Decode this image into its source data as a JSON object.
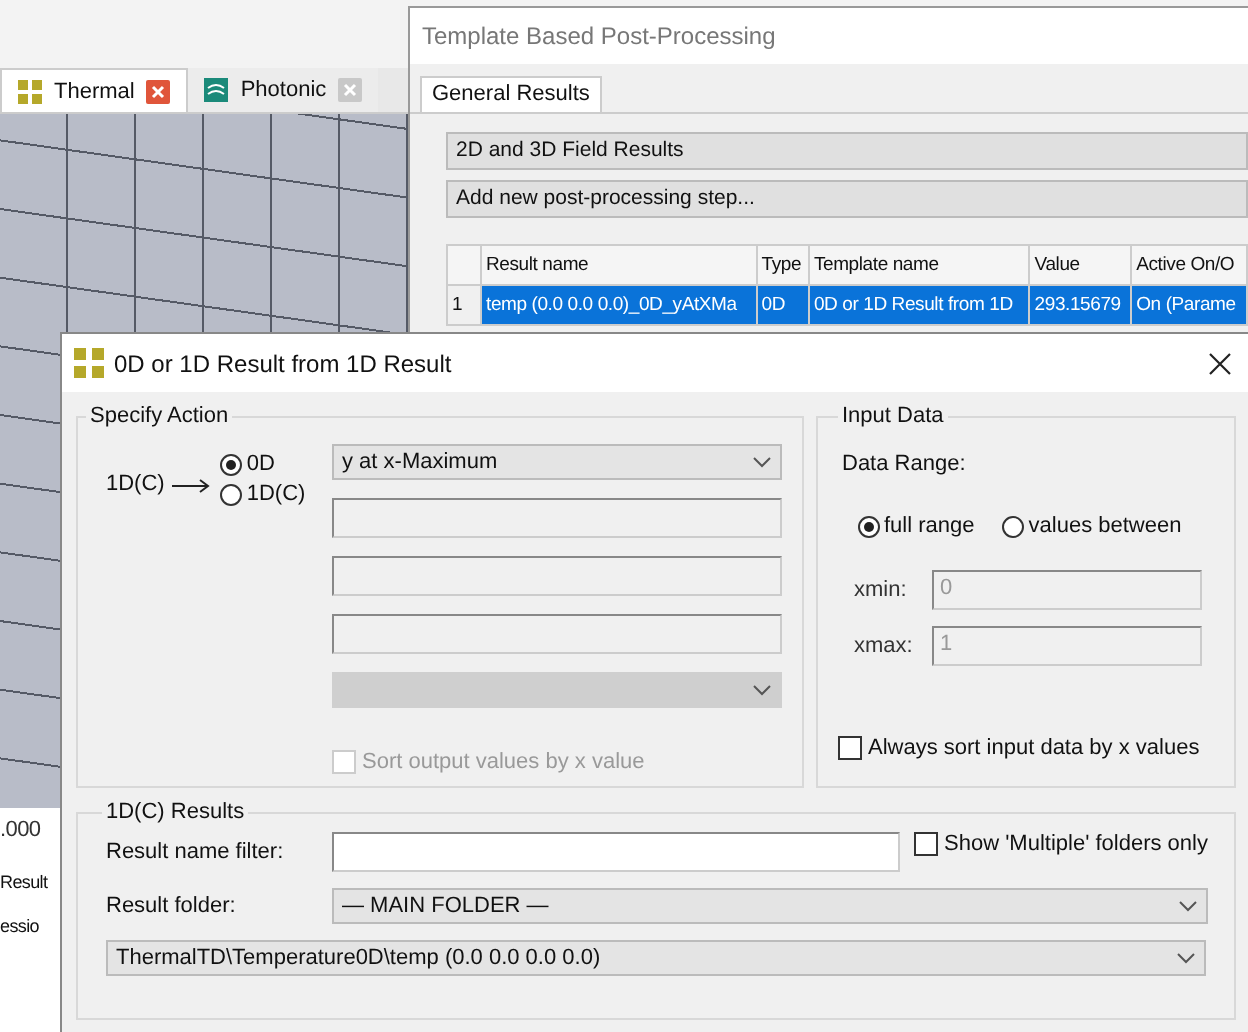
{
  "app": {
    "tabs": [
      {
        "label": "Thermal",
        "selected": true
      },
      {
        "label": "Photonic",
        "selected": false
      }
    ],
    "background_fragments": [
      ".000",
      "Result",
      "essio"
    ]
  },
  "template_window": {
    "title": "Template Based Post-Processing",
    "tabs": [
      {
        "label": "General Results",
        "selected": true
      }
    ],
    "sections": [
      "2D and 3D Field Results",
      "Add new post-processing step..."
    ],
    "table": {
      "columns": [
        "Result name",
        "Type",
        "Template name",
        "Value",
        "Active On/O"
      ],
      "rows": [
        {
          "number": "1",
          "selected": true,
          "cells": [
            "temp (0.0 0.0 0.0)_0D_yAtXMa",
            "0D",
            "0D or 1D Result from 1D",
            "293.15679",
            "On (Parame"
          ]
        }
      ]
    }
  },
  "dialog": {
    "title": "0D or 1D Result from 1D Result",
    "specify_action": {
      "title": "Specify Action",
      "source_label": "1D(C)",
      "targets": [
        {
          "label": "0D",
          "selected": true
        },
        {
          "label": "1D(C)",
          "selected": false
        }
      ],
      "action_dropdown": {
        "value": "y at x-Maximum",
        "disabled": false
      },
      "blank_fields": [
        {
          "disabled": true
        },
        {
          "disabled": true
        },
        {
          "disabled": true
        }
      ],
      "blank_dropdown": {
        "disabled": true
      },
      "sort_output": {
        "label": "Sort output values by x value",
        "checked": false,
        "disabled": true
      }
    },
    "input_data": {
      "title": "Input Data",
      "range_label": "Data Range:",
      "range_options": [
        {
          "label": "full range",
          "selected": true
        },
        {
          "label": "values between",
          "selected": false
        }
      ],
      "limits": [
        {
          "label": "xmin:",
          "value": "0",
          "disabled": true
        },
        {
          "label": "xmax:",
          "value": "1",
          "disabled": true
        }
      ],
      "always_sort": {
        "label": "Always sort input data by x values",
        "checked": false,
        "disabled": false
      }
    },
    "results": {
      "title": "1D(C) Results",
      "filter_label": "Result name filter:",
      "multiple_only": {
        "label": "Show 'Multiple' folders only",
        "checked": false,
        "disabled": false
      },
      "folder_label": "Result folder:",
      "folder_value": "— MAIN FOLDER —",
      "result_value": "ThermalTD\\Temperature0D\\temp (0.0 0.0 0.0 0.0)"
    }
  }
}
